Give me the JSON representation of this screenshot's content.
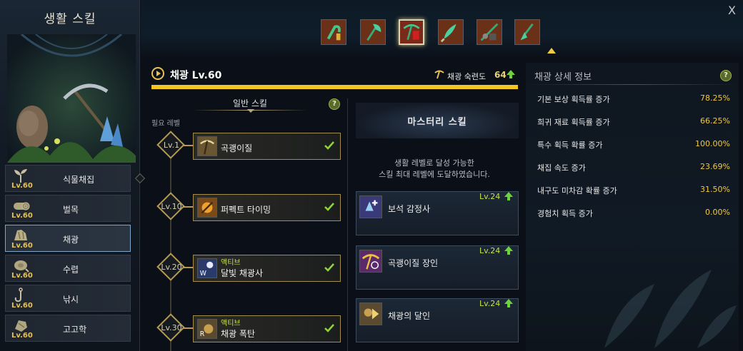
{
  "sidebar": {
    "title": "생활 스킬",
    "items": [
      {
        "label": "식물채집",
        "level": "Lv.60",
        "icon": "sprout-icon",
        "active": false
      },
      {
        "label": "벌목",
        "level": "Lv.60",
        "icon": "log-icon",
        "active": false
      },
      {
        "label": "채광",
        "level": "Lv.60",
        "icon": "ore-icon",
        "active": true
      },
      {
        "label": "수렵",
        "level": "Lv.60",
        "icon": "meat-icon",
        "active": false
      },
      {
        "label": "낚시",
        "level": "Lv.60",
        "icon": "fishing-hook-icon",
        "active": false
      },
      {
        "label": "고고학",
        "level": "Lv.60",
        "icon": "relic-icon",
        "active": false
      }
    ]
  },
  "topbar": {
    "tools": [
      "sickle-tool-icon",
      "axe-tool-icon",
      "pickaxe-tool-icon",
      "hunting-knife-tool-icon",
      "fishing-rod-tool-icon",
      "shovel-tool-icon"
    ],
    "active_tool_index": 2,
    "close_label": "X"
  },
  "skill": {
    "title": "채광 Lv.60",
    "mastery_label": "채광 숙련도",
    "mastery_value": "64",
    "progress": 1.0
  },
  "general": {
    "tab_label": "일반 스킬",
    "req_level_label": "필요 레벨",
    "help": "?",
    "skills": [
      {
        "level": "Lv.1",
        "type": "",
        "name": "곡괭이질",
        "icon": "pickaxe-swing-icon",
        "learned": true
      },
      {
        "level": "Lv.10",
        "type": "",
        "name": "퍼펙트 타이밍",
        "icon": "perfect-timing-icon",
        "learned": true
      },
      {
        "level": "Lv.20",
        "type": "액티브",
        "name": "달빛 채광사",
        "icon": "moonlight-miner-icon",
        "key": "W",
        "learned": true
      },
      {
        "level": "Lv.30",
        "type": "액티브",
        "name": "채광 폭탄",
        "icon": "mining-bomb-icon",
        "key": "R",
        "learned": true
      }
    ]
  },
  "mastery": {
    "title": "마스터리 스킬",
    "desc_line1": "생활 레벨로 달성 가능한",
    "desc_line2": "스킬 최대 레벨에 도달하였습니다.",
    "skills": [
      {
        "name": "보석 감정사",
        "level": "Lv.24",
        "icon": "gem-appraiser-icon"
      },
      {
        "name": "곡괭이질 장인",
        "level": "Lv.24",
        "icon": "pickaxe-master-icon"
      },
      {
        "name": "채광의 달인",
        "level": "Lv.24",
        "icon": "mining-expert-icon"
      }
    ]
  },
  "info": {
    "title": "채광 상세 정보",
    "help": "?",
    "stats": [
      {
        "label": "기본 보상 획득률 증가",
        "value": "78.25%"
      },
      {
        "label": "희귀 재료 획득률 증가",
        "value": "66.25%"
      },
      {
        "label": "특수 획득 확률 증가",
        "value": "100.00%"
      },
      {
        "label": "채집 속도 증가",
        "value": "23.69%"
      },
      {
        "label": "내구도 미차감 확률 증가",
        "value": "31.50%"
      },
      {
        "label": "경험치 획득 증가",
        "value": "0.00%"
      }
    ]
  },
  "colors": {
    "gold": "#f3c520",
    "level_green": "#c6e34a",
    "stat_value": "#f0c848",
    "active_border": "#7fa6c8"
  }
}
